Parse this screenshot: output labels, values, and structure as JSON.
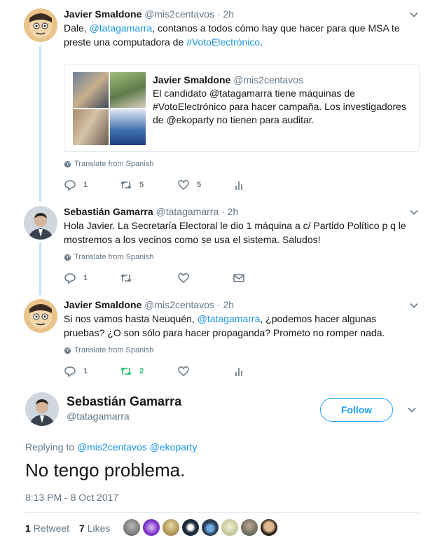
{
  "tweets": [
    {
      "name": "Javier Smaldone",
      "handle": "@mis2centavos",
      "dot": "·",
      "time": "2h",
      "text_pre": "Dale, ",
      "mention": "@tatagamarra",
      "text_mid": ", contanos a todos cómo hay que hacer para que MSA te preste una computadora de ",
      "hashtag": "#VotoElectrónico",
      "text_post": ".",
      "translate": "Translate from Spanish",
      "replies": "1",
      "retweets": "5",
      "likes": "5"
    },
    {
      "name": "Sebastián Gamarra",
      "handle": "@tatagamarra",
      "dot": "·",
      "time": "2h",
      "text": "Hola Javier. La Secretaría Electoral le dio 1 máquina a c/ Partido Político p q le mostremos a los vecinos como se usa el sistema. Saludos!",
      "translate": "Translate from Spanish",
      "replies": "1"
    },
    {
      "name": "Javier Smaldone",
      "handle": "@mis2centavos",
      "dot": "·",
      "time": "2h",
      "text_pre": "Si nos vamos hasta Neuquén, ",
      "mention": "@tatagamarra",
      "text_post": ", ¿podemos hacer algunas pruebas? ¿O son sólo para hacer propaganda? Prometo no romper nada.",
      "translate": "Translate from Spanish",
      "replies": "1",
      "retweets": "2"
    }
  ],
  "quote": {
    "name": "Javier Smaldone",
    "handle": "@mis2centavos",
    "text": "El candidato @tatagamarra tiene máquinas de #VotoElectrónico para hacer campaña. Los investigadores de @ekoparty no tienen para auditar."
  },
  "main": {
    "name": "Sebastián Gamarra",
    "handle": "@tatagamarra",
    "follow_label": "Follow",
    "replying_label": "Replying to",
    "reply_to_1": "@mis2centavos",
    "reply_to_2": "@ekoparty",
    "text": "No tengo problema.",
    "date": "8:13 PM - 8 Oct 2017",
    "retweet_count": "1",
    "retweet_label": "Retweet",
    "like_count": "7",
    "like_label": "Likes"
  },
  "colors": {
    "accent": "#1da1f2",
    "retweet_active": "#17bf63",
    "thread_line": "#c4e3f7"
  }
}
